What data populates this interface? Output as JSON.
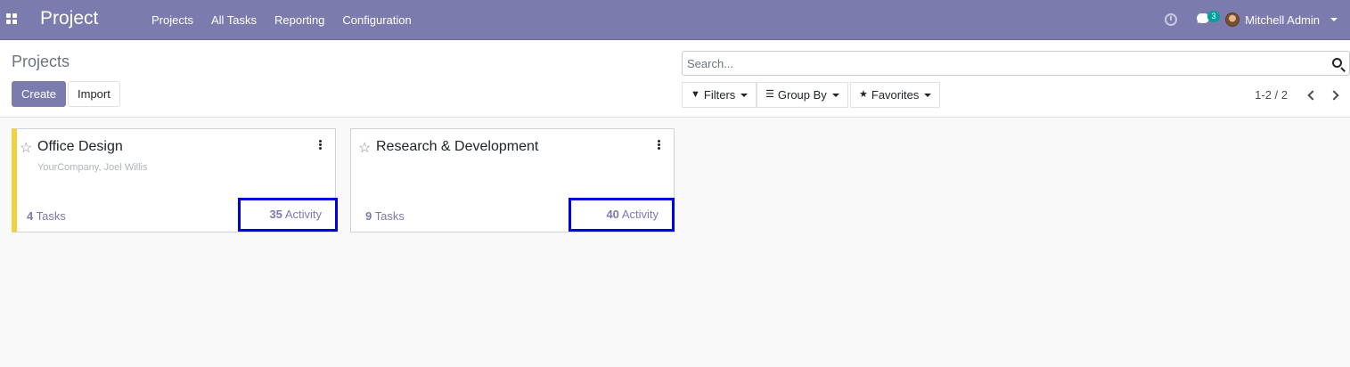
{
  "navbar": {
    "app_title": "Project",
    "menu": [
      "Projects",
      "All Tasks",
      "Reporting",
      "Configuration"
    ],
    "message_count": "3",
    "user_name": "Mitchell Admin"
  },
  "control_panel": {
    "breadcrumb": "Projects",
    "create_label": "Create",
    "import_label": "Import",
    "search_placeholder": "Search...",
    "filters_label": "Filters",
    "group_by_label": "Group By",
    "favorites_label": "Favorites",
    "pager": "1-2 / 2"
  },
  "projects": [
    {
      "name": "Office Design",
      "subtitle": "YourCompany, Joel Willis",
      "task_count": "4",
      "task_label": "Tasks",
      "activity_count": "35",
      "activity_label": "Activity"
    },
    {
      "name": "Research & Development",
      "subtitle": "",
      "task_count": "9",
      "task_label": "Tasks",
      "activity_count": "40",
      "activity_label": "Activity"
    }
  ],
  "colors": {
    "brand": "#7c7bad",
    "highlight_border": "#0000e0",
    "card_color_tag": "#f4d03f",
    "badge": "#00a09d"
  },
  "icons": [
    "apps-grid-icon",
    "clock-icon",
    "chat-icon",
    "avatar",
    "search-icon",
    "filter-icon",
    "group-by-icon",
    "star-icon",
    "kebab-icon",
    "chevron-left-icon",
    "chevron-right-icon"
  ]
}
